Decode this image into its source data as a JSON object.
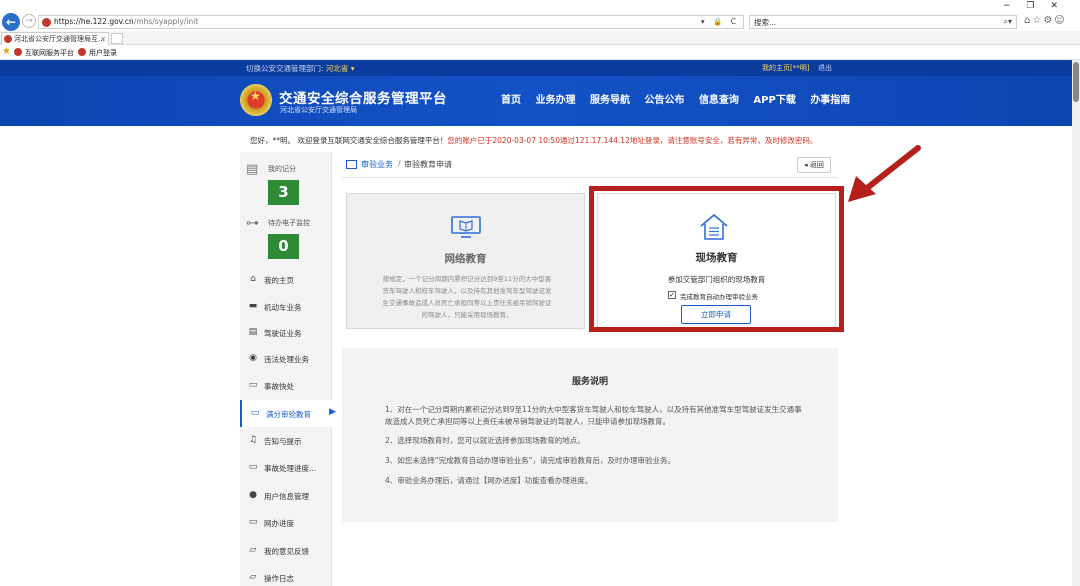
{
  "browser": {
    "url_main": "https://he.122.gov.cn",
    "url_path": "/mhs/syapply/init",
    "addr_controls": "▾ 🔒 C",
    "search_placeholder": "搜索...",
    "search_controls": "⌕▾",
    "tool_icons": "⌂☆⚙☺",
    "window_controls": "−❐✕",
    "tab_title": "河北省公安厅交通管理局互...",
    "tab_close": "×",
    "favorites": [
      "互联网服务平台",
      "用户登录"
    ]
  },
  "site": {
    "switch_label": "切换公安交通管理部门:",
    "province": "河北省 ▾",
    "my_home": "我的主页[**明]",
    "logout": "退出",
    "title": "交通安全综合服务管理平台",
    "subtitle": "河北省公安厅交通管理局",
    "nav": [
      "首页",
      "业务办理",
      "服务导航",
      "公告公布",
      "信息查询",
      "APP下载",
      "办事指南"
    ]
  },
  "notice": {
    "greeting": "您好，**明。 欢迎登录互联网交通安全综合服务管理平台！",
    "alert": "您的账户已于2020-03-07 10:50通过121.17.144.12地址登录，请注意账号安全，若有异常，及时修改密码。"
  },
  "sidebar": {
    "score_label": "我的记分",
    "score_value": "3",
    "pending_label": "待办电子监控",
    "pending_value": "0",
    "items": [
      {
        "label": "我的主页",
        "icon": "home-icon"
      },
      {
        "label": "机动车业务",
        "icon": "car-icon"
      },
      {
        "label": "驾驶证业务",
        "icon": "license-icon"
      },
      {
        "label": "违法处理业务",
        "icon": "camera-icon"
      },
      {
        "label": "事故快处",
        "icon": "accident-icon"
      },
      {
        "label": "满分审验教育",
        "icon": "education-icon"
      },
      {
        "label": "告知与提示",
        "icon": "bell-icon"
      },
      {
        "label": "事故处理进度...",
        "icon": "progress-icon"
      },
      {
        "label": "用户信息管理",
        "icon": "user-icon"
      },
      {
        "label": "网办进度",
        "icon": "progress-icon"
      },
      {
        "label": "我的意见反馈",
        "icon": "feedback-icon"
      },
      {
        "label": "操作日志",
        "icon": "log-icon"
      }
    ]
  },
  "breadcrumb": {
    "section": "审验业务",
    "separator": "/",
    "current": "审验教育申请"
  },
  "back_button": "◂ 返回",
  "cards": {
    "online": {
      "title": "网络教育",
      "desc": "按规定，一个记分周期内累积记分达到9至11分的大中型客货车驾驶人和校车驾驶人，以及持有其他准驾车型驾驶证发生交通事故造成人员死亡承担同等以上责任未被吊销驾驶证的驾驶人，只能采用现场教育。"
    },
    "onsite": {
      "title": "现场教育",
      "subtitle": "参加交管部门组织的现场教育",
      "checkbox_label": "完成教育自动办理审验业务",
      "checkbox_checked": "✓",
      "apply_button": "立即申请"
    }
  },
  "service": {
    "title": "服务说明",
    "items": [
      "1、对在一个记分周期内累积记分达到9至11分的大中型客货车驾驶人和校车驾驶人，以及持有其他准驾车型驾驶证发生交通事故造成人员死亡承担同等以上责任未被吊销驾驶证的驾驶人，只能申请参加现场教育。",
      "2、选择现场教育时，您可以就近选择参加现场教育的地点。",
      "3、如您未选择“完成教育自动办理审验业务”，请完成审验教育后，及时办理审验业务。",
      "4、审验业务办理后，请通过【网办进度】功能查看办理进度。"
    ]
  },
  "colors": {
    "header_blue": "#1352c6",
    "accent_blue": "#1a5bd0",
    "badge_green": "#2f8a35",
    "annotation_red": "#b5201c",
    "alert_red": "#d0311d"
  }
}
